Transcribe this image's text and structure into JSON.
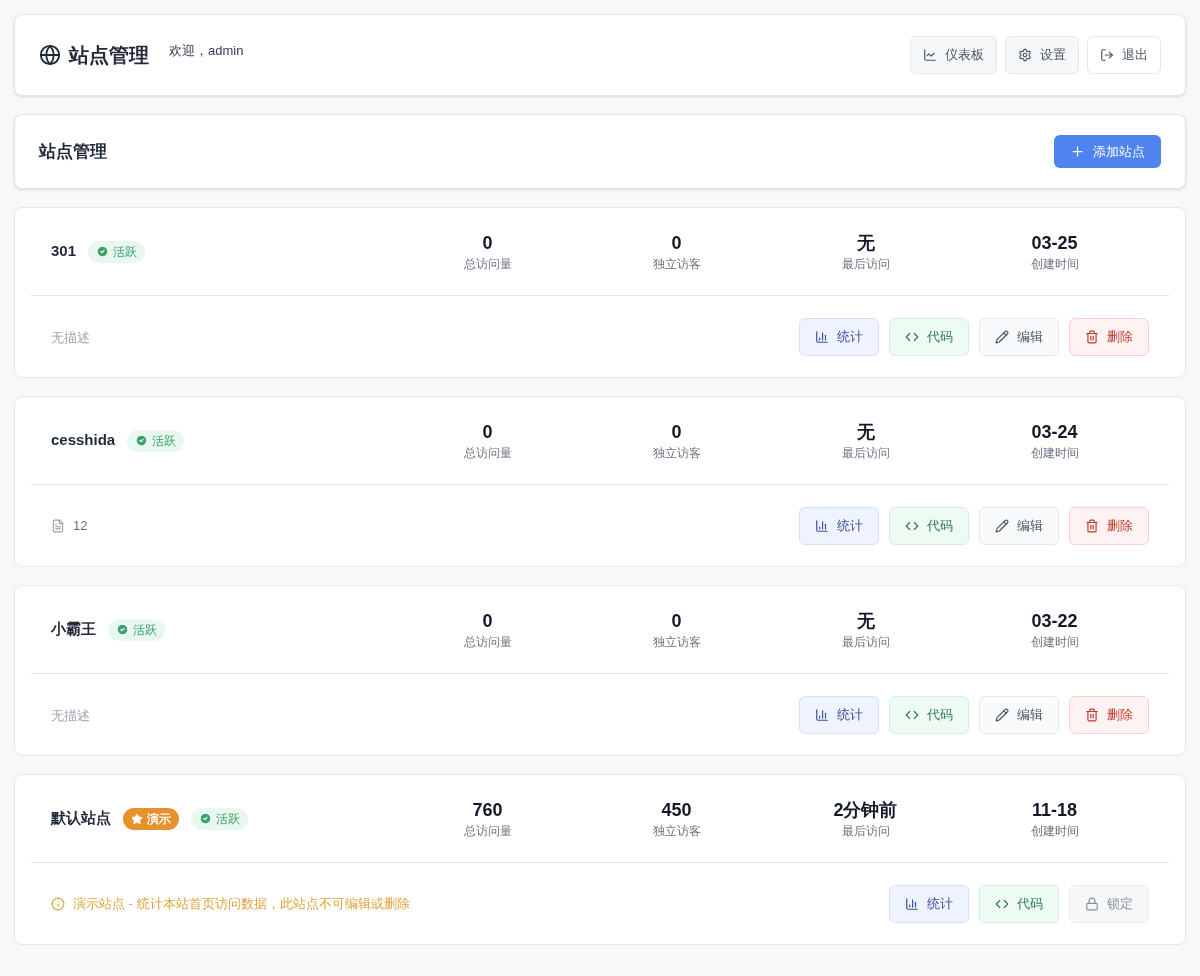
{
  "header": {
    "title": "站点管理",
    "welcome": "欢迎，admin",
    "nav": [
      {
        "kind": "dashboard",
        "label": "仪表板"
      },
      {
        "kind": "settings",
        "label": "设置"
      },
      {
        "kind": "logout",
        "label": "退出"
      }
    ]
  },
  "section": {
    "title": "站点管理",
    "add_button": "添加站点"
  },
  "sites": [
    {
      "name": "301",
      "badges": [
        {
          "kind": "active",
          "label": "活跃"
        }
      ],
      "stats": [
        {
          "value": "0",
          "label": "总访问量"
        },
        {
          "value": "0",
          "label": "独立访客"
        },
        {
          "value": "无",
          "label": "最后访问"
        },
        {
          "value": "03-25",
          "label": "创建时间"
        }
      ],
      "footer": {
        "kind": "empty",
        "text": "无描述"
      },
      "actions": [
        {
          "kind": "stats",
          "label": "统计",
          "disabled": false
        },
        {
          "kind": "code",
          "label": "代码",
          "disabled": false
        },
        {
          "kind": "edit",
          "label": "编辑",
          "disabled": false
        },
        {
          "kind": "delete",
          "label": "删除",
          "disabled": false
        }
      ]
    },
    {
      "name": "cesshida",
      "badges": [
        {
          "kind": "active",
          "label": "活跃"
        }
      ],
      "stats": [
        {
          "value": "0",
          "label": "总访问量"
        },
        {
          "value": "0",
          "label": "独立访客"
        },
        {
          "value": "无",
          "label": "最后访问"
        },
        {
          "value": "03-24",
          "label": "创建时间"
        }
      ],
      "footer": {
        "kind": "description",
        "text": "12"
      },
      "actions": [
        {
          "kind": "stats",
          "label": "统计",
          "disabled": false
        },
        {
          "kind": "code",
          "label": "代码",
          "disabled": false
        },
        {
          "kind": "edit",
          "label": "编辑",
          "disabled": false
        },
        {
          "kind": "delete",
          "label": "删除",
          "disabled": false
        }
      ]
    },
    {
      "name": "小霸王",
      "badges": [
        {
          "kind": "active",
          "label": "活跃"
        }
      ],
      "stats": [
        {
          "value": "0",
          "label": "总访问量"
        },
        {
          "value": "0",
          "label": "独立访客"
        },
        {
          "value": "无",
          "label": "最后访问"
        },
        {
          "value": "03-22",
          "label": "创建时间"
        }
      ],
      "footer": {
        "kind": "empty",
        "text": "无描述"
      },
      "actions": [
        {
          "kind": "stats",
          "label": "统计",
          "disabled": false
        },
        {
          "kind": "code",
          "label": "代码",
          "disabled": false
        },
        {
          "kind": "edit",
          "label": "编辑",
          "disabled": false
        },
        {
          "kind": "delete",
          "label": "删除",
          "disabled": false
        }
      ]
    },
    {
      "name": "默认站点",
      "badges": [
        {
          "kind": "demo",
          "label": "演示"
        },
        {
          "kind": "active",
          "label": "活跃"
        }
      ],
      "stats": [
        {
          "value": "760",
          "label": "总访问量"
        },
        {
          "value": "450",
          "label": "独立访客"
        },
        {
          "value": "2分钟前",
          "label": "最后访问"
        },
        {
          "value": "11-18",
          "label": "创建时间"
        }
      ],
      "footer": {
        "kind": "notice",
        "text": "演示站点 - 统计本站首页访问数据，此站点不可编辑或删除"
      },
      "actions": [
        {
          "kind": "stats",
          "label": "统计",
          "disabled": false
        },
        {
          "kind": "code",
          "label": "代码",
          "disabled": false
        },
        {
          "kind": "lock",
          "label": "锁定",
          "disabled": true
        }
      ]
    }
  ]
}
